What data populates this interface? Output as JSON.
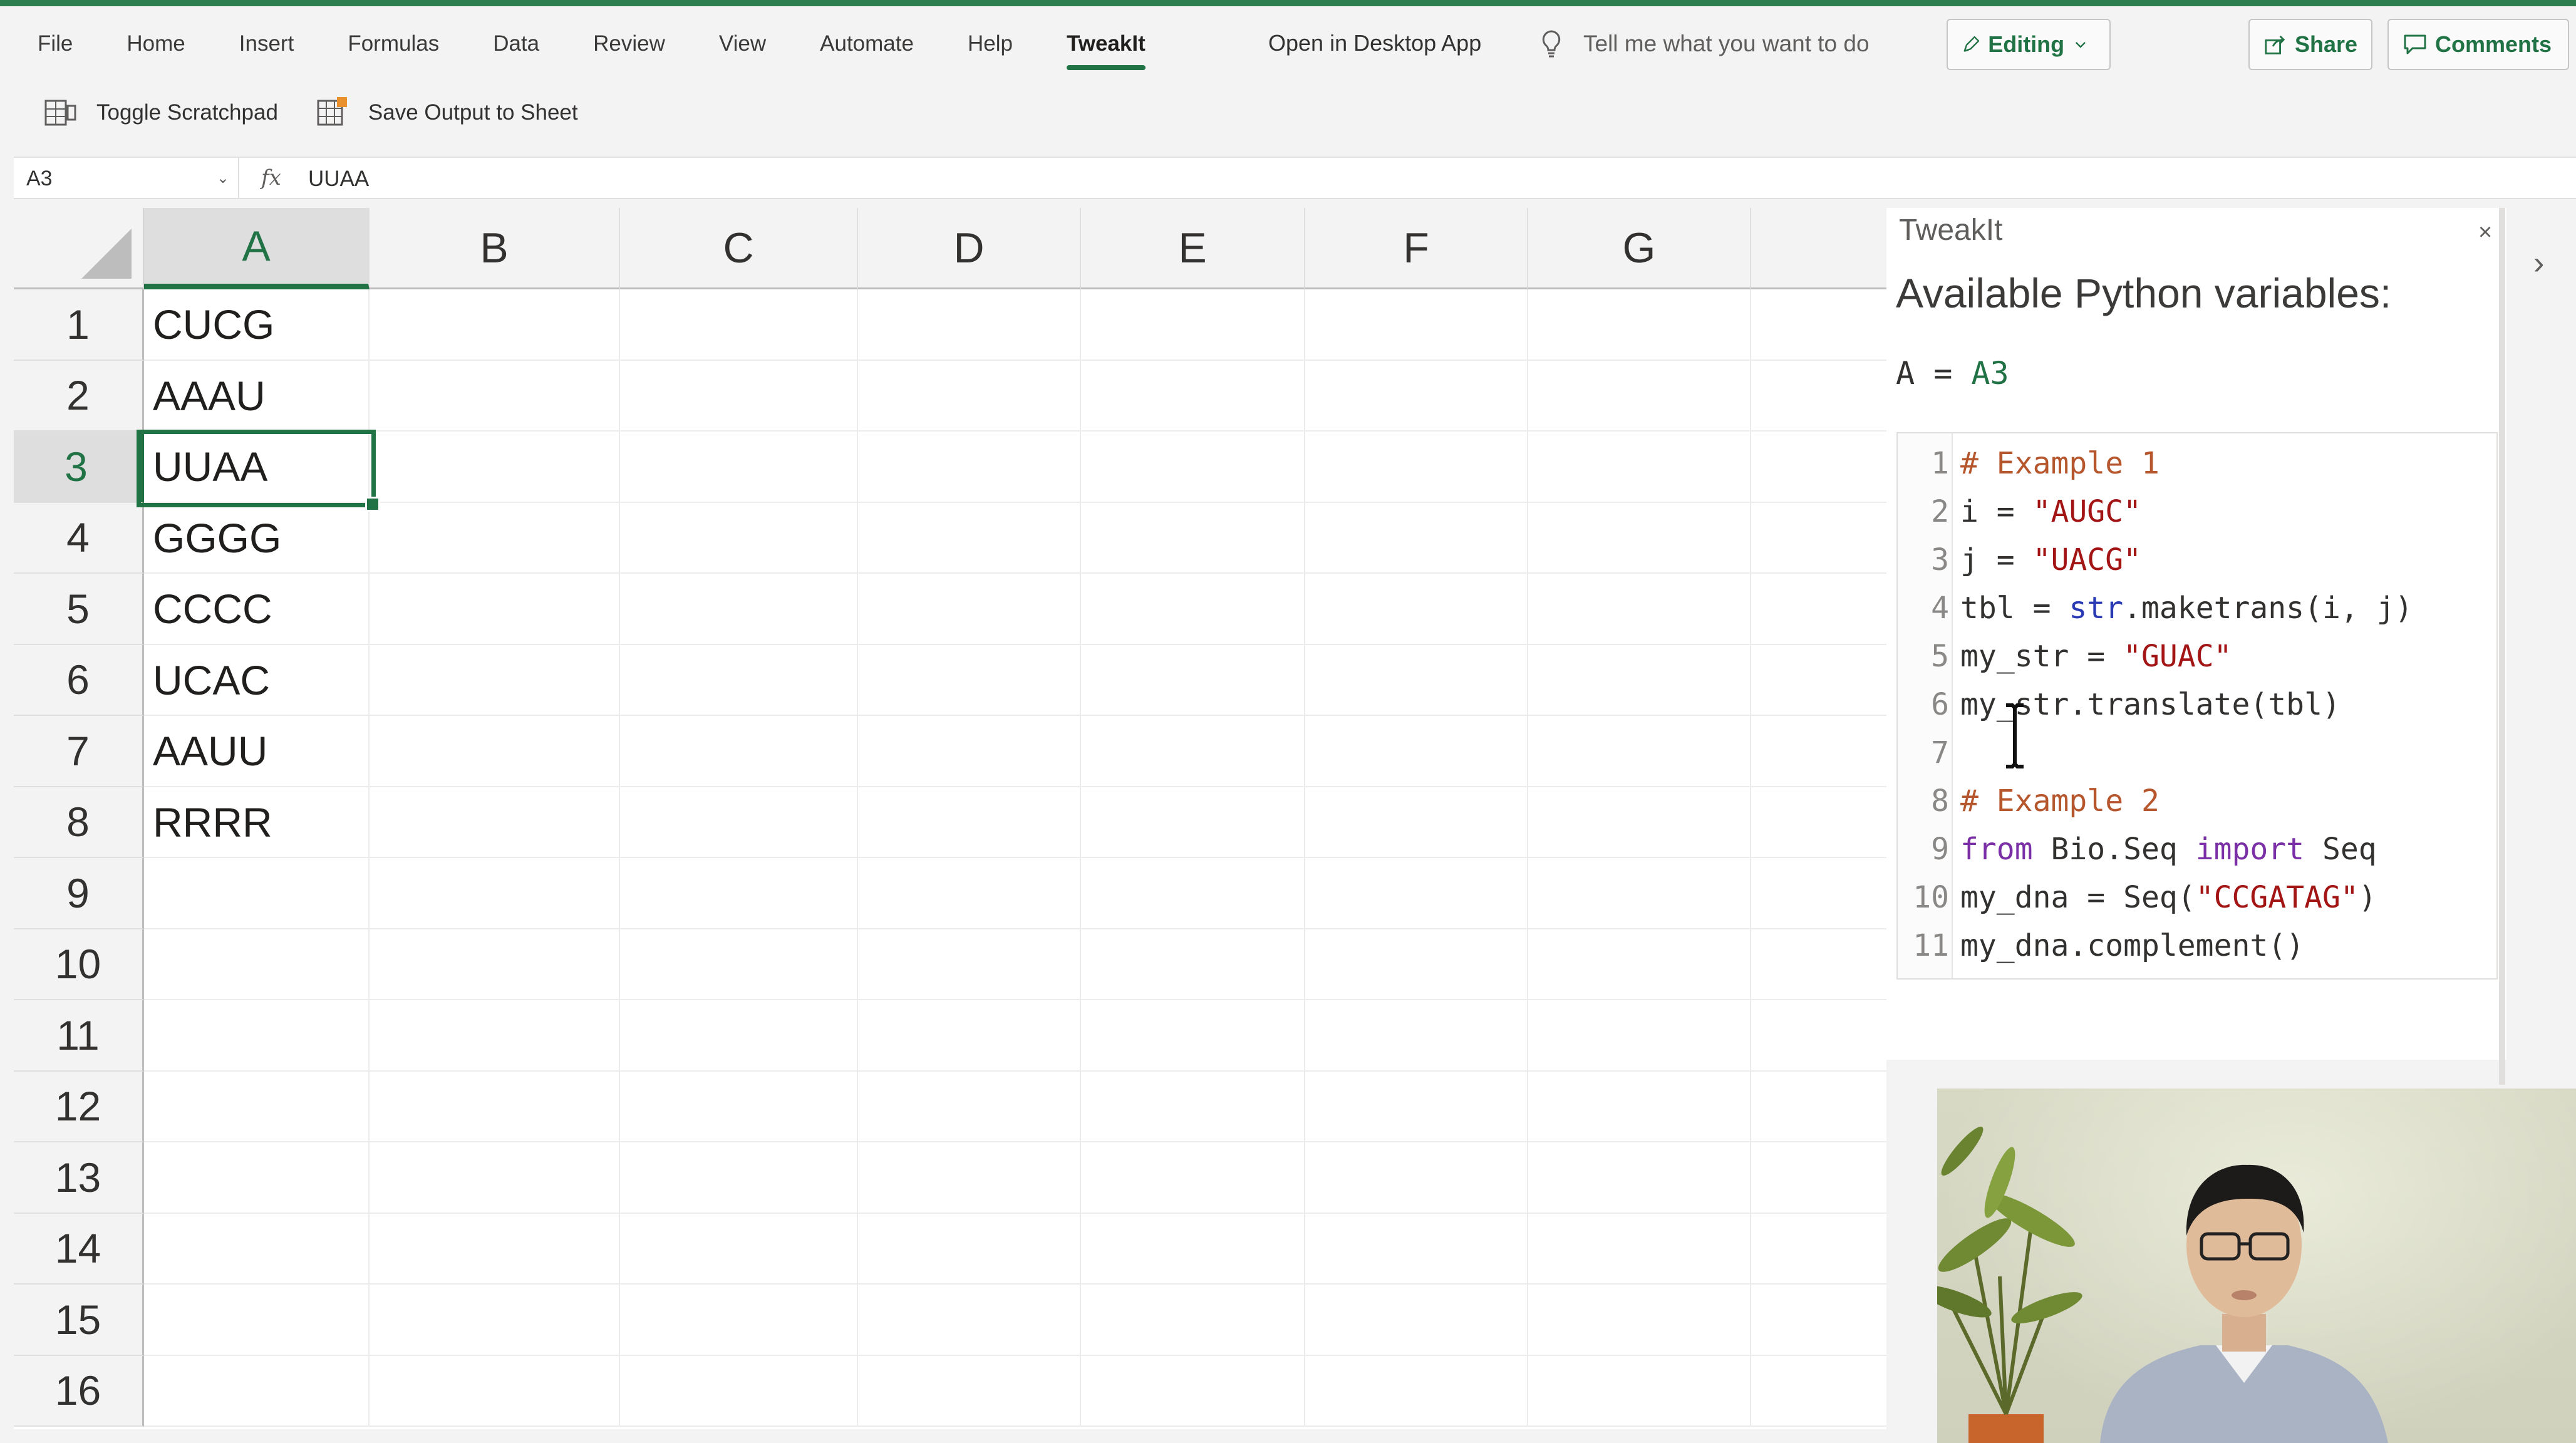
{
  "ribbon": {
    "tabs": [
      "File",
      "Home",
      "Insert",
      "Formulas",
      "Data",
      "Review",
      "View",
      "Automate",
      "Help",
      "TweakIt"
    ],
    "active_tab": "TweakIt",
    "open_desktop": "Open in Desktop App",
    "tell_me": "Tell me what you want to do",
    "editing_label": "Editing",
    "share_label": "Share",
    "comments_label": "Comments"
  },
  "commands": {
    "toggle_scratchpad": "Toggle Scratchpad",
    "save_output": "Save Output to Sheet"
  },
  "formula_bar": {
    "name_box": "A3",
    "fx": "fx",
    "value": "UUAA"
  },
  "sheet": {
    "columns": [
      "A",
      "B",
      "C",
      "D",
      "E",
      "F",
      "G"
    ],
    "selected_column": "A",
    "rows": [
      "1",
      "2",
      "3",
      "4",
      "5",
      "6",
      "7",
      "8",
      "9",
      "10",
      "11",
      "12",
      "13",
      "14",
      "15",
      "16"
    ],
    "selected_row": "3",
    "column_a": [
      "CUCG",
      "AAAU",
      "UUAA",
      "GGGG",
      "CCCC",
      "UCAC",
      "AAUU",
      "RRRR"
    ]
  },
  "pane": {
    "title": "TweakIt",
    "close": "×",
    "heading": "Available Python variables:",
    "var_name": "A",
    "var_eq": " = ",
    "var_ref": "A3",
    "collapse": "›",
    "code_lines": [
      {
        "n": "1",
        "tokens": [
          [
            "c-comment",
            "# Example 1"
          ]
        ]
      },
      {
        "n": "2",
        "tokens": [
          [
            "",
            "i = "
          ],
          [
            "c-string",
            "\"AUGC\""
          ]
        ]
      },
      {
        "n": "3",
        "tokens": [
          [
            "",
            "j = "
          ],
          [
            "c-string",
            "\"UACG\""
          ]
        ]
      },
      {
        "n": "4",
        "tokens": [
          [
            "",
            "tbl = "
          ],
          [
            "c-builtin",
            "str"
          ],
          [
            "",
            ".maketrans(i, j)"
          ]
        ]
      },
      {
        "n": "5",
        "tokens": [
          [
            "",
            "my_str = "
          ],
          [
            "c-string",
            "\"GUAC\""
          ]
        ]
      },
      {
        "n": "6",
        "tokens": [
          [
            "",
            "my_str.translate(tbl)"
          ]
        ]
      },
      {
        "n": "7",
        "tokens": [
          [
            "",
            ""
          ]
        ]
      },
      {
        "n": "8",
        "tokens": [
          [
            "c-comment",
            "# Example 2"
          ]
        ]
      },
      {
        "n": "9",
        "tokens": [
          [
            "c-keyword",
            "from"
          ],
          [
            "",
            " Bio.Seq "
          ],
          [
            "c-keyword",
            "import"
          ],
          [
            "",
            " Seq"
          ]
        ]
      },
      {
        "n": "10",
        "tokens": [
          [
            "",
            "my_dna = Seq("
          ],
          [
            "c-string",
            "\"CCGATAG\""
          ],
          [
            "",
            ")"
          ]
        ]
      },
      {
        "n": "11",
        "tokens": [
          [
            "",
            "my_dna.complement()"
          ]
        ]
      }
    ]
  },
  "colors": {
    "accent": "#217346",
    "comment": "#b5562d",
    "string": "#a31515",
    "keyword": "#7b2fa6",
    "builtin": "#2a3ab5"
  }
}
